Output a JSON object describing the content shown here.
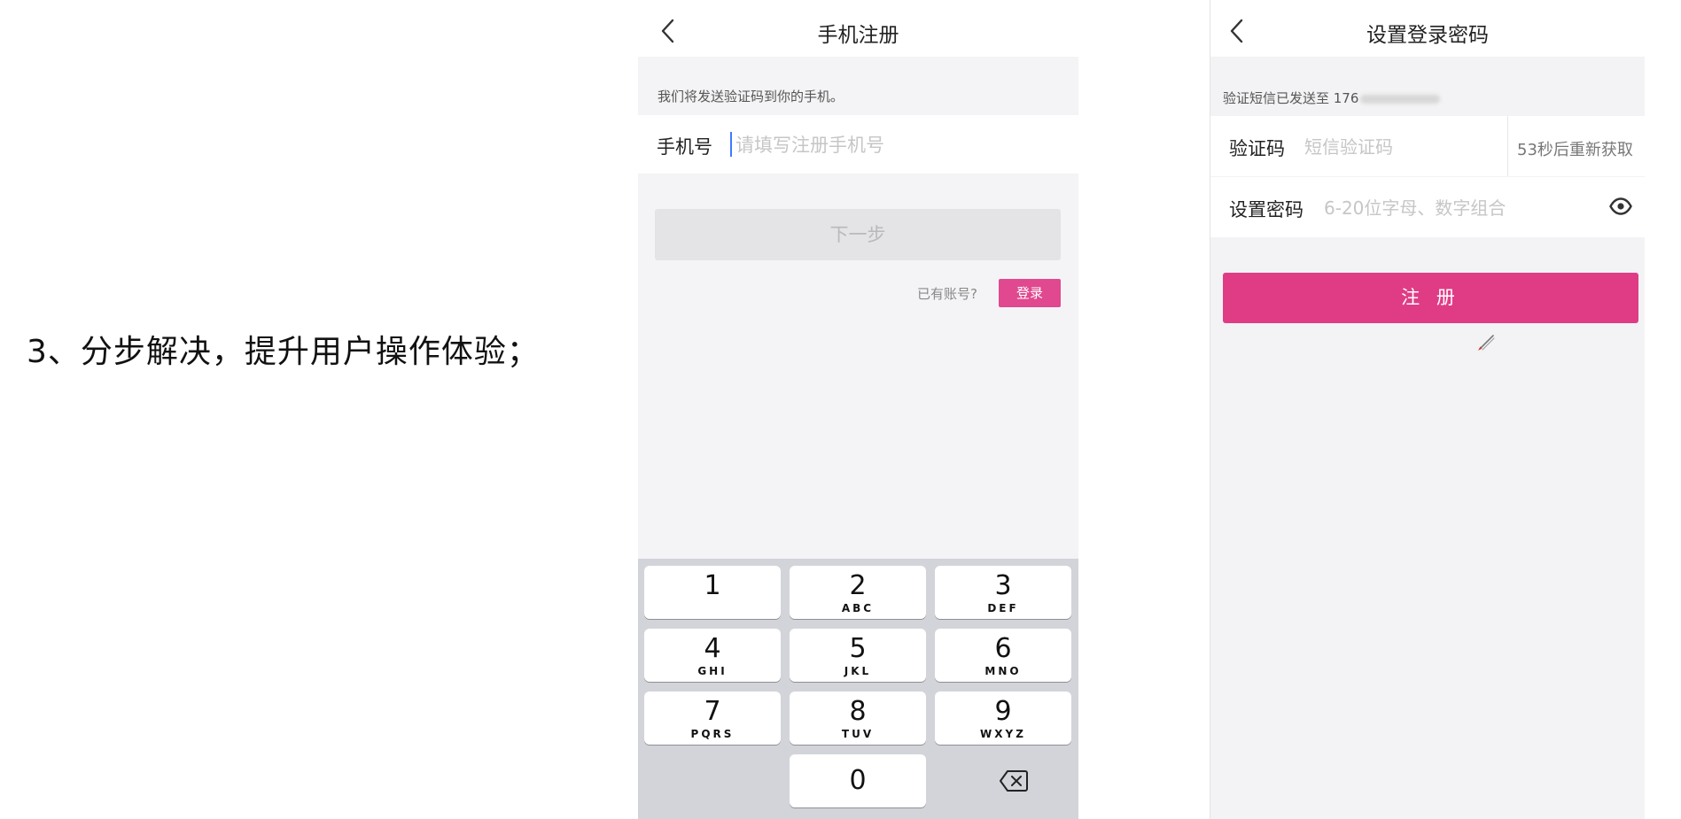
{
  "caption": "3、分步解决，提升用户操作体验；",
  "screen1": {
    "title": "手机注册",
    "info": "我们将发送验证码到你的手机。",
    "phone_label": "手机号",
    "phone_placeholder": "请填写注册手机号",
    "next_label": "下一步",
    "has_account": "已有账号?",
    "login_label": "登录",
    "keys": [
      {
        "num": "1",
        "letters": ""
      },
      {
        "num": "2",
        "letters": "ABC"
      },
      {
        "num": "3",
        "letters": "DEF"
      },
      {
        "num": "4",
        "letters": "GHI"
      },
      {
        "num": "5",
        "letters": "JKL"
      },
      {
        "num": "6",
        "letters": "MNO"
      },
      {
        "num": "7",
        "letters": "PQRS"
      },
      {
        "num": "8",
        "letters": "TUV"
      },
      {
        "num": "9",
        "letters": "WXYZ"
      },
      {
        "num": "0",
        "letters": ""
      }
    ]
  },
  "screen2": {
    "title": "设置登录密码",
    "info": "验证短信已发送至 176",
    "code_label": "验证码",
    "code_placeholder": "短信验证码",
    "resend": "53秒后重新获取",
    "password_label": "设置密码",
    "password_placeholder": "6-20位字母、数字组合",
    "register_label": "注 册"
  },
  "colors": {
    "accent": "#e03c86",
    "login_button": "#e0488f",
    "disabled_button": "#e4e4e6",
    "keyboard_bg": "#d2d4da"
  }
}
